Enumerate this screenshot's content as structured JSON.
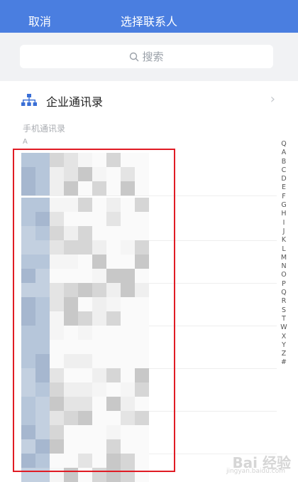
{
  "nav": {
    "cancel_label": "取消",
    "title": "选择联系人"
  },
  "search": {
    "placeholder": "搜索"
  },
  "org_directory": {
    "label": "企业通讯录",
    "chevron": "›"
  },
  "phone_section": {
    "title": "手机通讯录",
    "letter": "A"
  },
  "index_letters": [
    "Q",
    "A",
    "B",
    "C",
    "D",
    "E",
    "F",
    "G",
    "H",
    "I",
    "J",
    "K",
    "L",
    "M",
    "N",
    "O",
    "P",
    "Q",
    "R",
    "S",
    "T",
    "W",
    "X",
    "Y",
    "Z",
    "#"
  ],
  "colors": {
    "brand": "#4a7ee0",
    "highlight_border": "#e01b24"
  },
  "watermark": {
    "text": "Bai 经验",
    "sub": "jingyan.baidu.com"
  }
}
